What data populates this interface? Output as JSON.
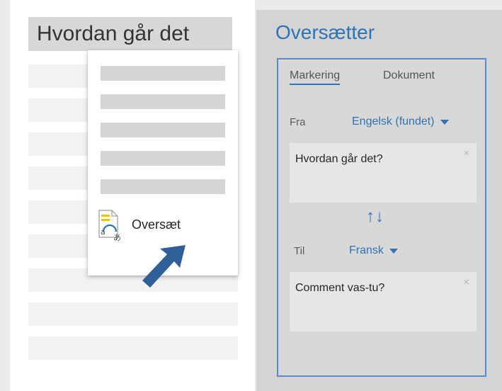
{
  "document": {
    "heading": "Hvordan går det"
  },
  "context_menu": {
    "translate_label": "Oversæt",
    "translate_icon": "translate-icon"
  },
  "translator": {
    "title": "Oversætter",
    "tabs": [
      {
        "label": "Markering",
        "active": true
      },
      {
        "label": "Dokument",
        "active": false
      }
    ],
    "from_label": "Fra",
    "from_language": "Engelsk (fundet)",
    "source_text": "Hvordan går det?",
    "swap_icon": "↑↓",
    "to_label": "Til",
    "to_language": "Fransk",
    "target_text": "Comment vas-tu?",
    "clear_icon": "×"
  },
  "colors": {
    "accent": "#2e74b5",
    "pane_background": "#d4d4d4",
    "cursor": "#2f5f98"
  }
}
